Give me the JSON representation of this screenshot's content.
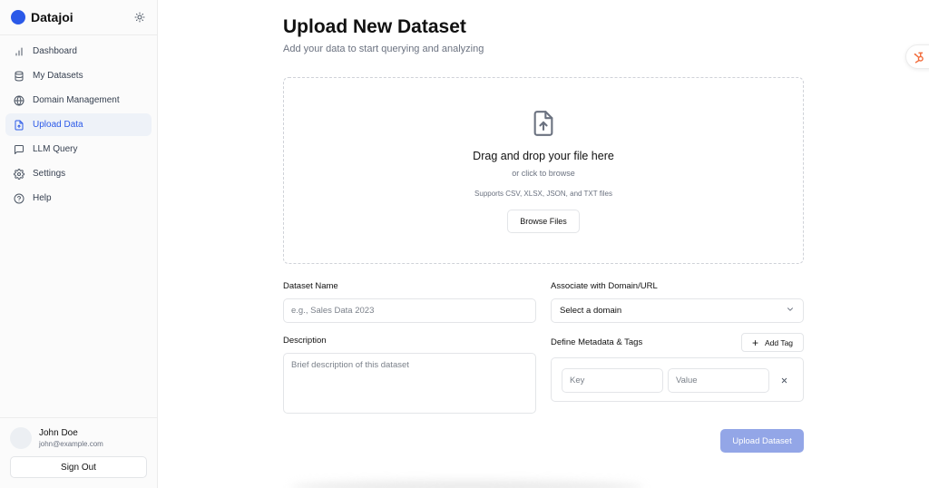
{
  "app": {
    "name": "Datajoi",
    "brand_color": "#2b59e8"
  },
  "sidebar": {
    "items": [
      {
        "label": "Dashboard",
        "icon": "bar-chart-icon"
      },
      {
        "label": "My Datasets",
        "icon": "database-icon"
      },
      {
        "label": "Domain Management",
        "icon": "globe-icon"
      },
      {
        "label": "Upload Data",
        "icon": "file-upload-icon",
        "active": true
      },
      {
        "label": "LLM Query",
        "icon": "message-square-icon"
      },
      {
        "label": "Settings",
        "icon": "gear-icon"
      },
      {
        "label": "Help",
        "icon": "help-circle-icon"
      }
    ],
    "user": {
      "name": "John Doe",
      "email": "john@example.com"
    },
    "sign_out_label": "Sign Out"
  },
  "main": {
    "title": "Upload New Dataset",
    "subtitle": "Add your data to start querying and analyzing",
    "dropzone": {
      "title": "Drag and drop your file here",
      "subtitle": "or click to browse",
      "note": "Supports CSV, XLSX, JSON, and TXT files",
      "browse_label": "Browse Files"
    },
    "dataset_name": {
      "label": "Dataset Name",
      "placeholder": "e.g., Sales Data 2023"
    },
    "domain": {
      "label": "Associate with Domain/URL",
      "selected": "Select a domain"
    },
    "description": {
      "label": "Description",
      "placeholder": "Brief description of this dataset"
    },
    "metadata": {
      "label": "Define Metadata & Tags",
      "add_tag_label": "Add Tag",
      "key_placeholder": "Key",
      "value_placeholder": "Value"
    },
    "upload_label": "Upload Dataset",
    "upload_color": "#93a6e7"
  }
}
